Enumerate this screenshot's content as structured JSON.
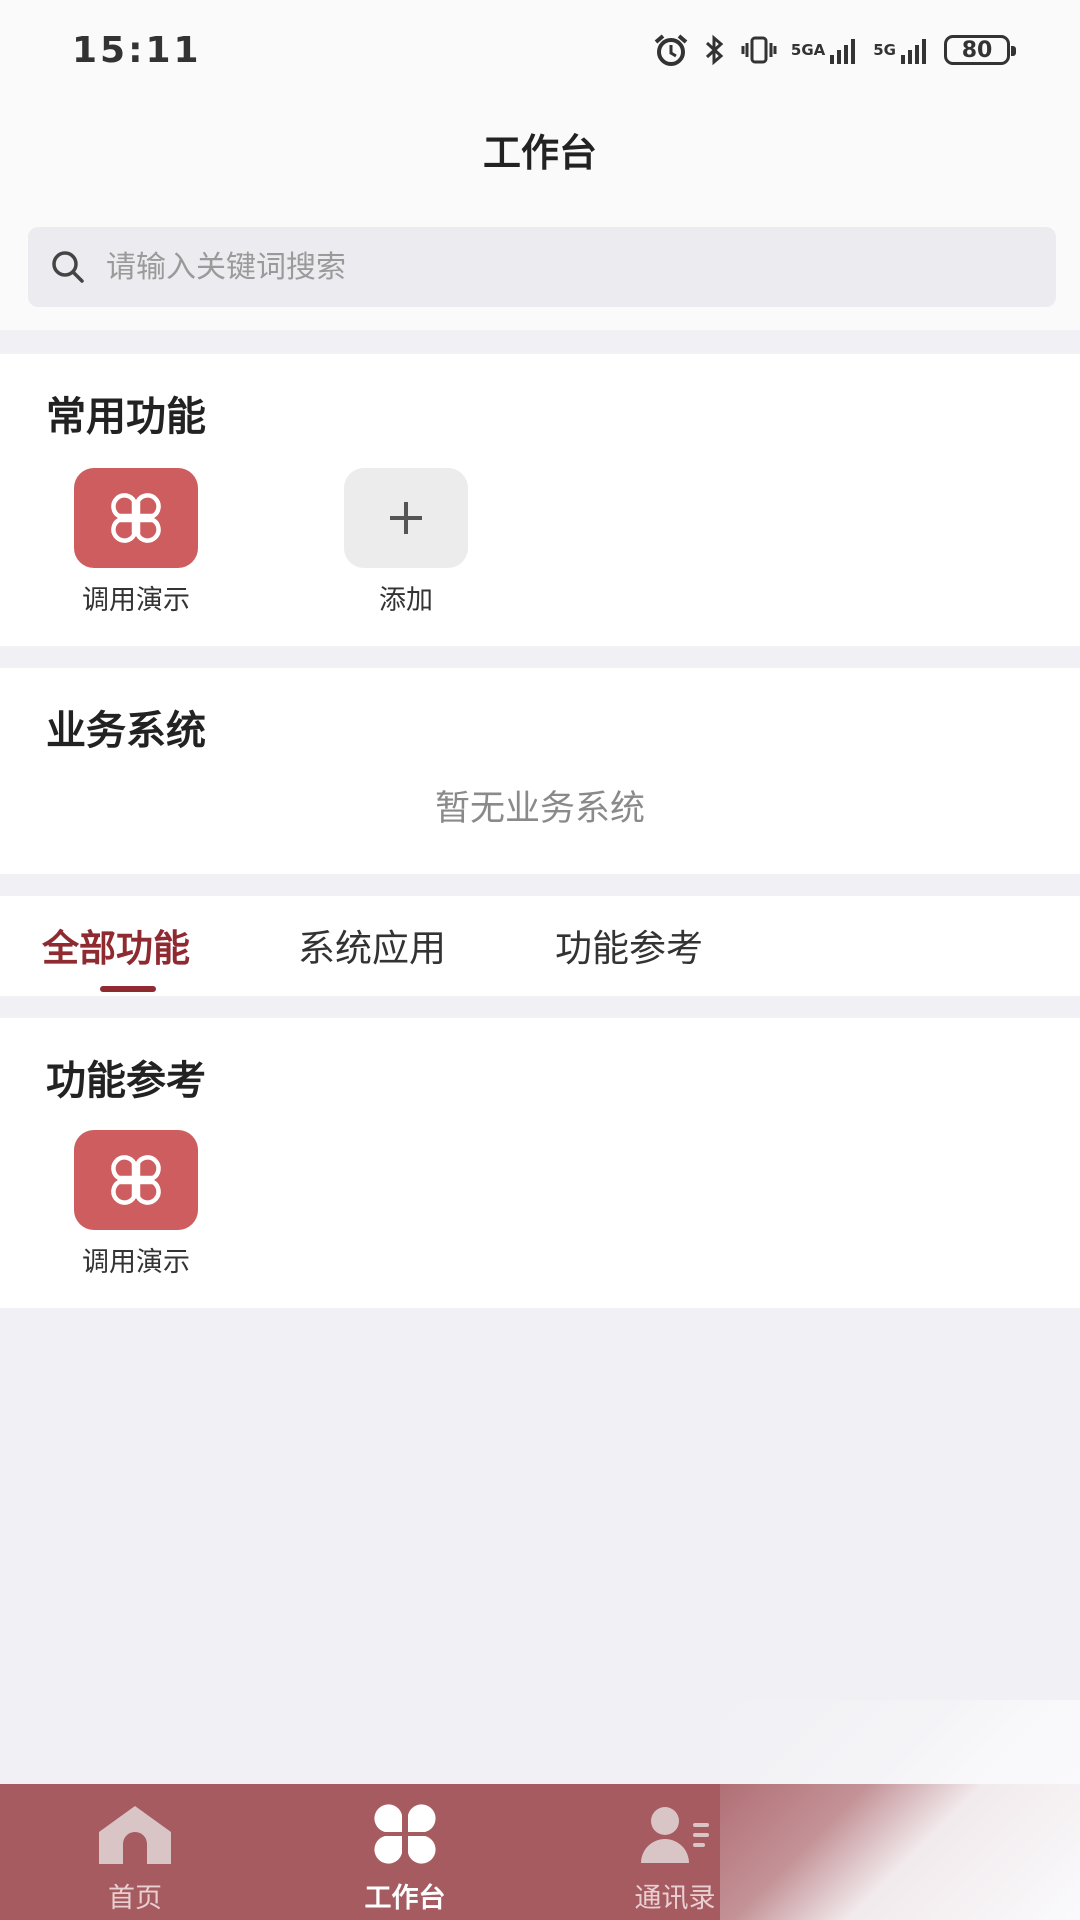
{
  "status_bar": {
    "time": "15:11",
    "network_1": "5GA",
    "network_2": "5G",
    "battery": "80"
  },
  "header": {
    "title": "工作台"
  },
  "search": {
    "placeholder": "请输入关键词搜索"
  },
  "common_functions": {
    "title": "常用功能",
    "items": [
      {
        "label": "调用演示",
        "icon": "clover-icon"
      },
      {
        "label": "添加",
        "icon": "plus-icon"
      }
    ]
  },
  "business_systems": {
    "title": "业务系统",
    "empty_text": "暂无业务系统"
  },
  "tabs": [
    {
      "label": "全部功能",
      "active": true
    },
    {
      "label": "系统应用",
      "active": false
    },
    {
      "label": "功能参考",
      "active": false
    }
  ],
  "function_reference": {
    "title": "功能参考",
    "items": [
      {
        "label": "调用演示",
        "icon": "clover-icon"
      }
    ]
  },
  "bottom_nav": [
    {
      "label": "首页",
      "icon": "home-icon",
      "active": false
    },
    {
      "label": "工作台",
      "icon": "clover-icon",
      "active": true
    },
    {
      "label": "通讯录",
      "icon": "contacts-icon",
      "active": false
    }
  ],
  "colors": {
    "accent": "#8e2a30",
    "tile_red": "#cd5d5f",
    "nav_bg": "#a65b61",
    "page_bg": "#f1f1f5"
  }
}
